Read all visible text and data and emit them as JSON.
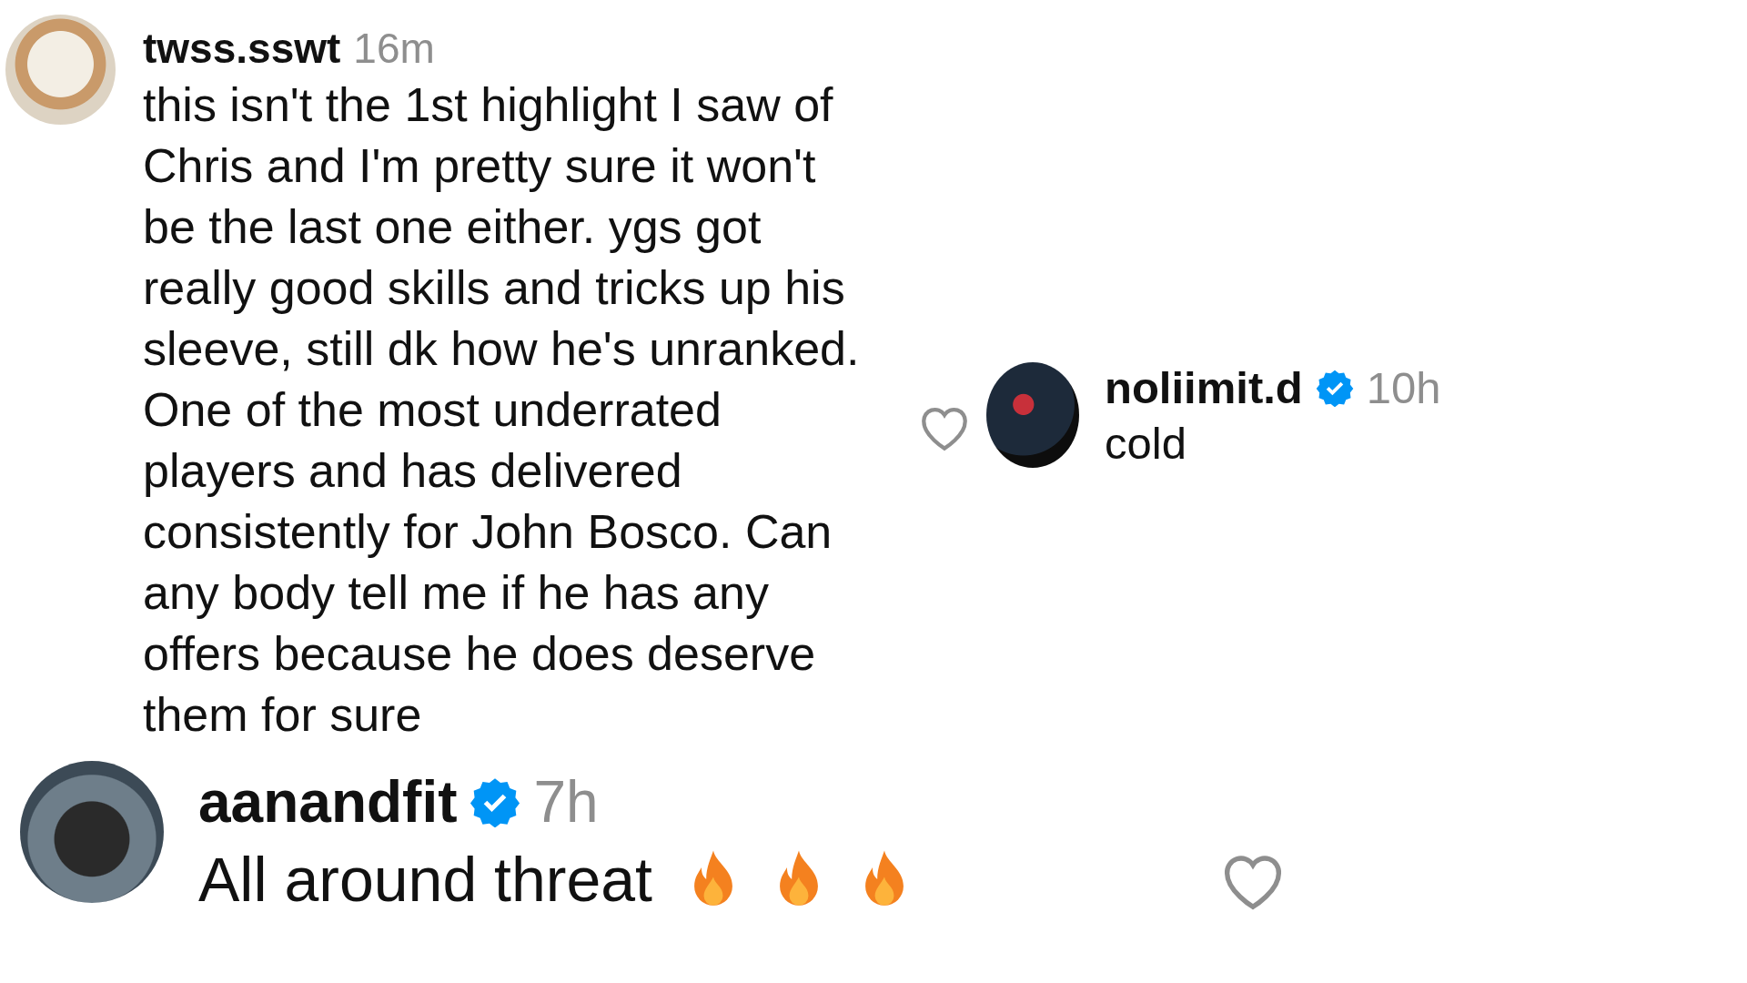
{
  "comments": [
    {
      "username": "twss.sswt",
      "verified": false,
      "time": "16m",
      "text": "this isn't the 1st highlight I saw of Chris and I'm pretty sure it won't be the last one either. ygs got really good skills and tricks up his sleeve, still dk how he's unranked. One of the most underrated players and has delivered consistently for John Bosco. Can any body tell me if he has any offers because he does deserve them for sure"
    },
    {
      "username": "noliimit.d",
      "verified": true,
      "time": "10h",
      "text": "cold"
    },
    {
      "username": "aanandfit",
      "verified": true,
      "time": "7h",
      "text": "All around threat"
    }
  ]
}
